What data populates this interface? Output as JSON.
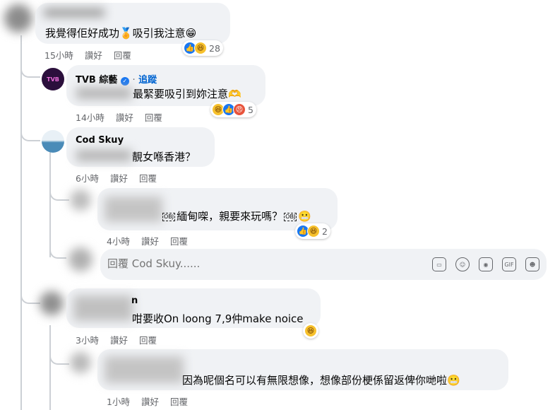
{
  "comments": [
    {
      "text": "我覺得佢好成功🏅吸引我注意😁",
      "time": "15小時",
      "reaction_count": "28"
    },
    {
      "author": "TVB 綜藝",
      "follow": "追蹤",
      "text": "最緊要吸引到妳注意🫶",
      "time": "14小時",
      "reaction_count": "5"
    },
    {
      "author": "Cod Skuy",
      "text": "靚女喺香港？",
      "time": "6小時"
    },
    {
      "text_pre": "緬甸㗎，親要來玩嗎？",
      "chip": "OBJ",
      "time": "4小時",
      "reaction_count": "2"
    },
    {
      "author_tail": "n",
      "text": "咁要收On loong 7,9仲make noice",
      "time": "3小時"
    },
    {
      "text": "因為呢個名可以有無限想像，想像部份梗係留返俾你哋啦😬",
      "time": "1小時"
    }
  ],
  "actions": {
    "like": "讚好",
    "reply": "回覆"
  },
  "reply_box": {
    "placeholder": "回覆 Cod Skuy......"
  },
  "icons": [
    "sticker-icon",
    "emoji-icon",
    "camera-icon",
    "gif-icon",
    "sticker-face-icon"
  ],
  "colors": {
    "bubble": "#f0f2f5",
    "meta": "#65676b",
    "like": "#1877f2",
    "haha": "#f7c12c"
  }
}
